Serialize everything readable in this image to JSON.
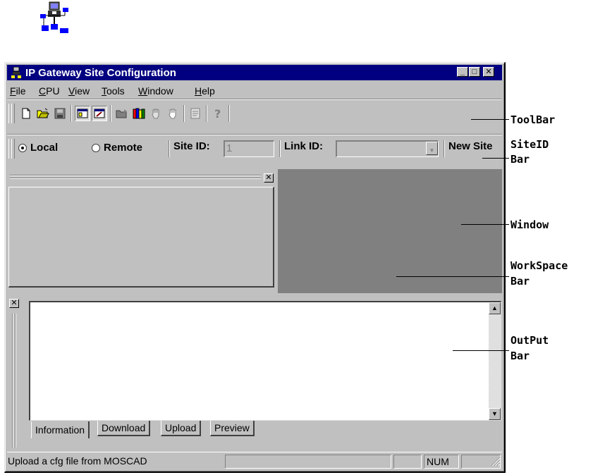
{
  "app": {
    "title": "IP Gateway Site Configuration",
    "caption_buttons": {
      "minimize": "_",
      "maximize": "□",
      "close": "✕"
    }
  },
  "menu": [
    "File",
    "CPU",
    "View",
    "Tools",
    "Window",
    "Help"
  ],
  "toolbar": {
    "buttons": [
      "new-file-icon",
      "open-folder-icon",
      "save-disk-icon",
      "workspace-icon",
      "output-icon",
      "folder-arrow-icon",
      "books-icon",
      "hand-icon",
      "hand-outline-icon",
      "properties-icon",
      "help-icon"
    ]
  },
  "siteid_bar": {
    "local_label": "Local",
    "remote_label": "Remote",
    "selected": "Local",
    "site_id_label": "Site ID:",
    "site_id_value": "1",
    "link_id_label": "Link ID:",
    "link_id_value": "",
    "new_site_label": "New Site"
  },
  "workspace": {
    "close_label": "✕"
  },
  "output": {
    "close_label": "✕",
    "tabs": [
      "Information",
      "Download",
      "Upload",
      "Preview"
    ],
    "active_tab": "Information"
  },
  "status": {
    "message": "Upload a cfg file from MOSCAD",
    "num": "NUM"
  },
  "callouts": {
    "toolbar": "ToolBar",
    "siteid_1": "SiteID",
    "siteid_2": "Bar",
    "window": "Window",
    "workspace_1": "WorkSpace",
    "workspace_2": "Bar",
    "output_1": "OutPut",
    "output_2": "Bar"
  },
  "colors": {
    "titlebar": "#000080",
    "face": "#c0c0c0",
    "mdi_background": "#808080"
  }
}
